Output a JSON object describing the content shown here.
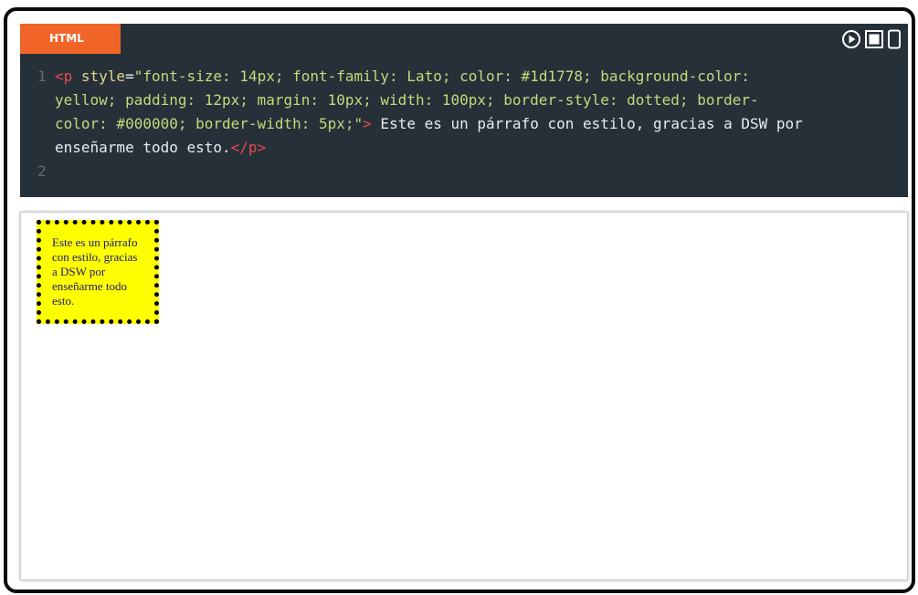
{
  "editor": {
    "tab_label": "HTML",
    "controls": [
      {
        "icon": "run-icon"
      },
      {
        "icon": "stop-icon"
      },
      {
        "icon": "device-icon"
      }
    ],
    "lines": [
      {
        "number": "1",
        "segments": [
          {
            "text": "<p",
            "kind": "tag"
          },
          {
            "text": " style",
            "kind": "attr"
          },
          {
            "text": "=",
            "kind": "text"
          },
          {
            "text": "\"font-size: 14px; font-family: Lato; color: #1d1778; background-color:",
            "kind": "str"
          }
        ]
      },
      {
        "number": "",
        "segments": [
          {
            "text": "yellow; padding: 12px; margin: 10px; width: 100px; border-style: dotted; border-",
            "kind": "str"
          }
        ]
      },
      {
        "number": "",
        "segments": [
          {
            "text": "color: #000000; border-width: 5px;\"",
            "kind": "str"
          },
          {
            "text": ">",
            "kind": "tag"
          },
          {
            "text": " Este es un párrafo con estilo, gracias a DSW por",
            "kind": "text"
          }
        ]
      },
      {
        "number": "",
        "segments": [
          {
            "text": "enseñarme todo esto.",
            "kind": "text"
          },
          {
            "text": "</p>",
            "kind": "tag"
          }
        ]
      },
      {
        "number": "2",
        "segments": []
      }
    ]
  },
  "preview": {
    "paragraph_text": "Este es un párrafo con estilo, gracias a DSW por enseñarme todo esto."
  },
  "colors": {
    "editor_bg": "#263039",
    "tab_bg": "#f16529",
    "paragraph_bg": "yellow",
    "paragraph_text": "#1d1778",
    "paragraph_border": "#000000"
  }
}
